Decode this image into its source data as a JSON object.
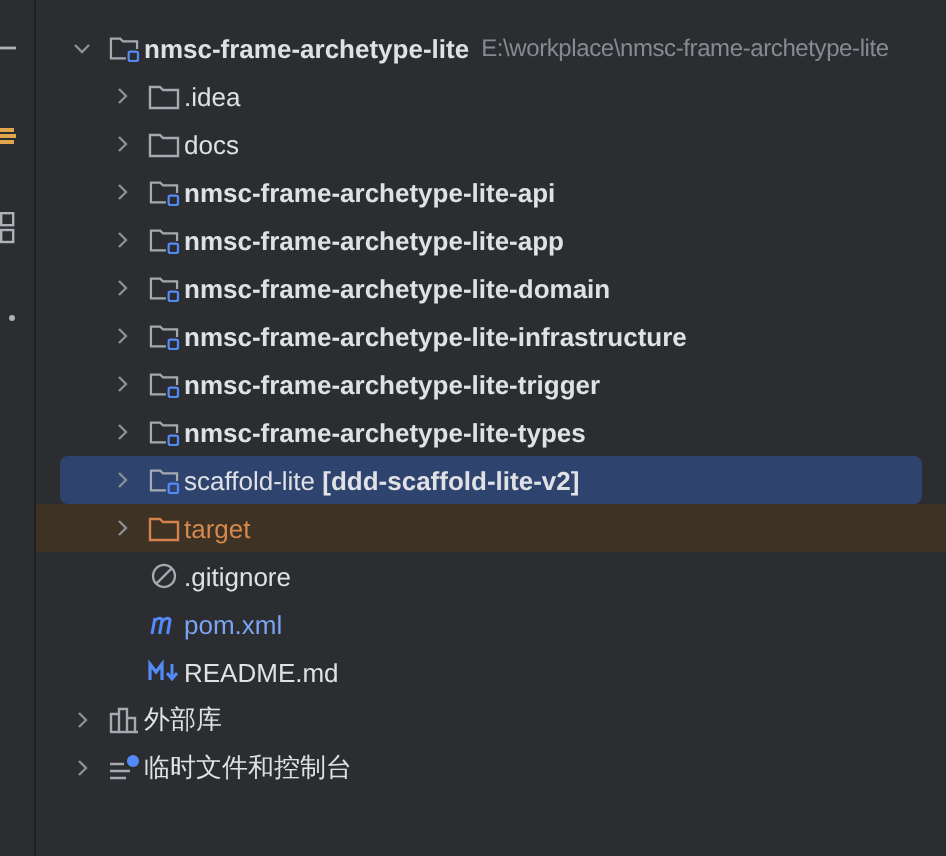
{
  "tree": [
    {
      "kind": "module",
      "label": "nmsc-frame-archetype-lite",
      "bold": true,
      "path": "E:\\workplace\\nmsc-frame-archetype-lite",
      "expanded": true,
      "selected": false,
      "children": [
        {
          "kind": "folder",
          "label": ".idea",
          "bold": false,
          "expanded": false,
          "selected": false
        },
        {
          "kind": "folder",
          "label": "docs",
          "bold": false,
          "expanded": false,
          "selected": false
        },
        {
          "kind": "module",
          "label": "nmsc-frame-archetype-lite-api",
          "bold": true,
          "expanded": false,
          "selected": false
        },
        {
          "kind": "module",
          "label": "nmsc-frame-archetype-lite-app",
          "bold": true,
          "expanded": false,
          "selected": false
        },
        {
          "kind": "module",
          "label": "nmsc-frame-archetype-lite-domain",
          "bold": true,
          "expanded": false,
          "selected": false
        },
        {
          "kind": "module",
          "label": "nmsc-frame-archetype-lite-infrastructure",
          "bold": true,
          "expanded": false,
          "selected": false
        },
        {
          "kind": "module",
          "label": "nmsc-frame-archetype-lite-trigger",
          "bold": true,
          "expanded": false,
          "selected": false
        },
        {
          "kind": "module",
          "label": "nmsc-frame-archetype-lite-types",
          "bold": true,
          "expanded": false,
          "selected": false
        },
        {
          "kind": "module",
          "label": "scaffold-lite **[ddd-scaffold-lite-v2]**",
          "bold": false,
          "expanded": false,
          "selected": true
        },
        {
          "kind": "excluded",
          "label": "target",
          "bold": false,
          "expanded": false,
          "selected": false
        },
        {
          "kind": "ignore",
          "label": ".gitignore",
          "bold": false,
          "selected": false
        },
        {
          "kind": "maven",
          "label": "pom.xml",
          "bold": false,
          "selected": false
        },
        {
          "kind": "markdown",
          "label": "README.md",
          "bold": false,
          "selected": false
        }
      ]
    },
    {
      "kind": "library",
      "label": "外部库",
      "bold": false,
      "expanded": false,
      "selected": false
    },
    {
      "kind": "scratch",
      "label": "临时文件和控制台",
      "bold": false,
      "expanded": false,
      "selected": false
    }
  ]
}
